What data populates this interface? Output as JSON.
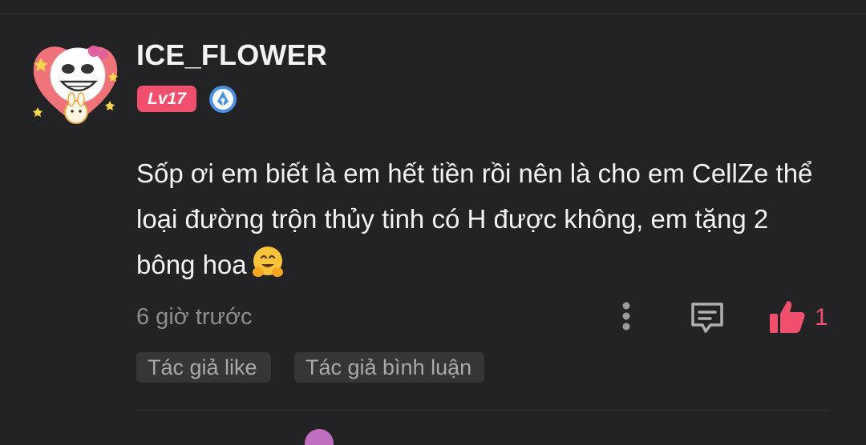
{
  "comment": {
    "username": "ICE_FLOWER",
    "level": "Lv17",
    "text": "Sốp ơi em biết là em hết tiền rồi nên là cho em CellZe thể loại đường trộn thủy tinh có H được không, em tặng 2 bông hoa",
    "emoji": "hugging-face",
    "timestamp": "6 giờ trước",
    "like_count": "1",
    "tags": [
      "Tác giả like",
      "Tác giả bình luận"
    ]
  },
  "colors": {
    "background": "#232224",
    "accent": "#f0506e",
    "text": "#f2f2f2",
    "muted": "#8e8d91",
    "tag_bg": "#363538"
  },
  "icons": [
    "avatar",
    "creator-badge-icon",
    "more-options-icon",
    "reply-icon",
    "like-icon",
    "hugging-face-emoji-icon"
  ]
}
